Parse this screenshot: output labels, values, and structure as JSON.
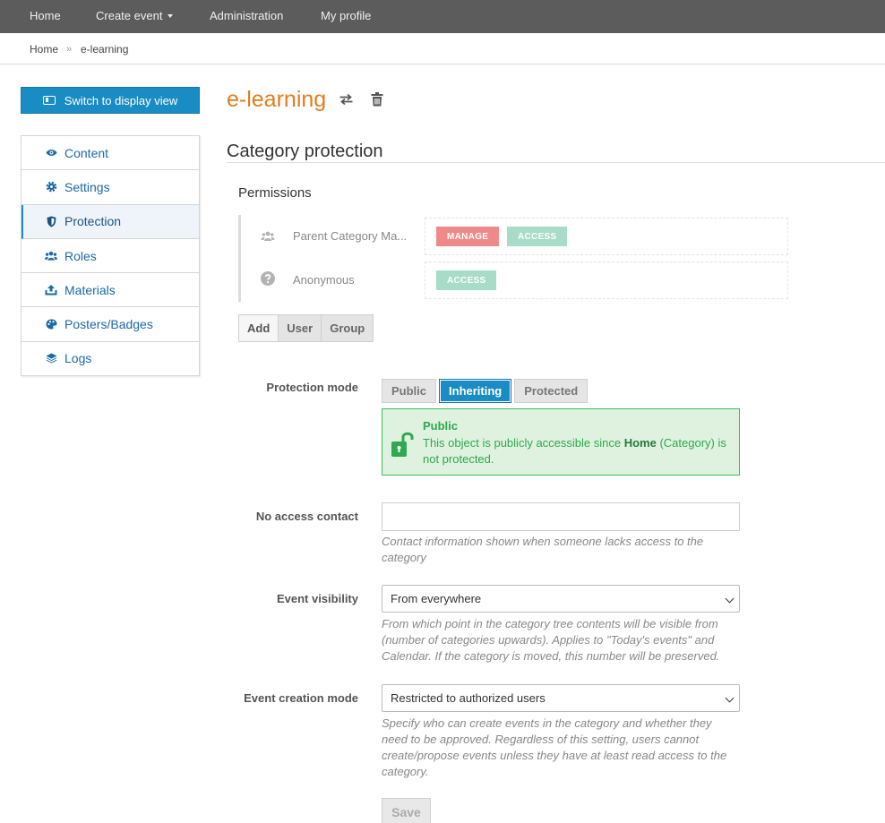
{
  "topnav": {
    "home": "Home",
    "create_event": "Create event",
    "administration": "Administration",
    "my_profile": "My profile"
  },
  "breadcrumb": {
    "home": "Home",
    "separator": "»",
    "current": "e-learning"
  },
  "switch_button": "Switch to display view",
  "sidemenu": [
    {
      "label": "Content",
      "icon": "eye-icon"
    },
    {
      "label": "Settings",
      "icon": "gear-icon"
    },
    {
      "label": "Protection",
      "icon": "shield-icon",
      "active": true
    },
    {
      "label": "Roles",
      "icon": "users-icon"
    },
    {
      "label": "Materials",
      "icon": "upload-icon"
    },
    {
      "label": "Posters/Badges",
      "icon": "palette-icon"
    },
    {
      "label": "Logs",
      "icon": "stack-icon"
    }
  ],
  "page_title": "e-learning",
  "section_title": "Category protection",
  "permissions": {
    "title": "Permissions",
    "rows": [
      {
        "label": "Parent Category Ma...",
        "icon": "users-icon",
        "tags": [
          "MANAGE",
          "ACCESS"
        ]
      },
      {
        "label": "Anonymous",
        "icon": "question-circle-icon",
        "tags": [
          "ACCESS"
        ]
      }
    ],
    "add_buttons": [
      "Add",
      "User",
      "Group"
    ]
  },
  "protection_mode": {
    "label": "Protection mode",
    "options": [
      "Public",
      "Inheriting",
      "Protected"
    ],
    "selected": "Inheriting",
    "notice_title": "Public",
    "notice_text_before": "This object is publicly accessible since ",
    "notice_bold": "Home",
    "notice_text_after": " (Category) is not protected."
  },
  "no_access_contact": {
    "label": "No access contact",
    "value": "",
    "help": "Contact information shown when someone lacks access to the category"
  },
  "event_visibility": {
    "label": "Event visibility",
    "value": "From everywhere",
    "help": "From which point in the category tree contents will be visible from (number of categories upwards). Applies to \"Today's events\" and Calendar. If the category is moved, this number will be preserved."
  },
  "event_creation_mode": {
    "label": "Event creation mode",
    "value": "Restricted to authorized users",
    "help": "Specify who can create events in the category and whether they need to be approved. Regardless of this setting, users cannot create/propose events unless they have at least read access to the category."
  },
  "save_label": "Save",
  "colors": {
    "topnav": "#5c5c5c",
    "accent": "#1a8cc4",
    "title": "#e07d1e",
    "public_green": "#2fa84f",
    "manage_red": "#f08a8a",
    "access_green": "#a7dcc9"
  }
}
